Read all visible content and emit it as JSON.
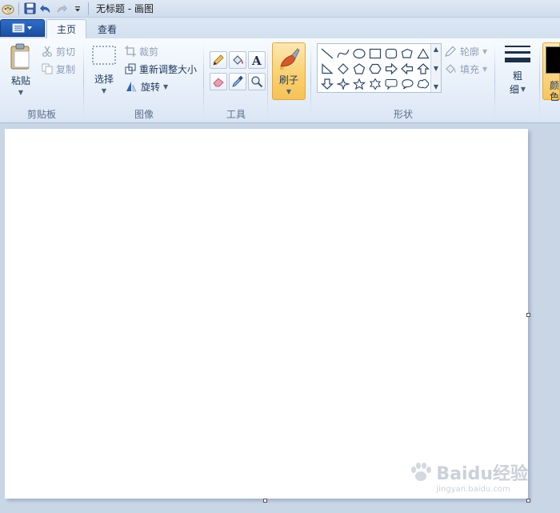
{
  "window": {
    "title": "无标题 - 画图"
  },
  "tabs": [
    {
      "label": "主页",
      "active": true
    },
    {
      "label": "查看",
      "active": false
    }
  ],
  "clipboard": {
    "paste_label": "粘贴",
    "cut_label": "剪切",
    "copy_label": "复制",
    "group_label": "剪贴板"
  },
  "image": {
    "select_label": "选择",
    "crop_label": "裁剪",
    "resize_label": "重新调整大小",
    "rotate_label": "旋转",
    "group_label": "图像"
  },
  "tools": {
    "group_label": "工具",
    "items": [
      "pencil-tool",
      "fill-tool",
      "text-tool",
      "eraser-tool",
      "color-picker-tool",
      "magnifier-tool"
    ]
  },
  "brushes": {
    "label": "刷子"
  },
  "shapes": {
    "group_label": "形状",
    "outline_label": "轮廓",
    "fill_label": "填充",
    "items": [
      "line",
      "curve",
      "oval",
      "rectangle",
      "rounded-rectangle",
      "polygon",
      "triangle",
      "right-triangle",
      "diamond",
      "pentagon",
      "hexagon",
      "right-arrow",
      "left-arrow",
      "up-arrow",
      "down-arrow",
      "four-point-star",
      "five-point-star",
      "six-point-star",
      "rounded-callout",
      "oval-callout",
      "cloud-callout"
    ]
  },
  "size": {
    "line1": "粗",
    "line2": "细"
  },
  "colors": {
    "line1": "颜",
    "line2": "色",
    "color1": "#000000"
  },
  "watermark": {
    "brand": "Baidu经验",
    "url": "jingyan.baidu.com"
  }
}
